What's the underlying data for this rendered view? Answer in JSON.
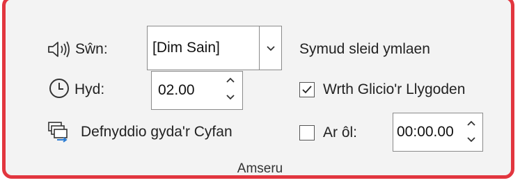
{
  "sound": {
    "label": "Sŵn:",
    "value": "[Dim Sain]"
  },
  "advance_label": "Symud sleid ymlaen",
  "duration": {
    "label": "Hyd:",
    "value": "02.00"
  },
  "on_mouse_click": {
    "label": "Wrth Glicio'r Llygoden",
    "checked": true
  },
  "apply_all": {
    "label": "Defnyddio gyda'r Cyfan"
  },
  "after": {
    "label": "Ar ôl:",
    "checked": false,
    "value": "00:00.00"
  },
  "group_label": "Amseru",
  "colors": {
    "highlight_border": "#e2363f",
    "panel_background": "#f3f3f3",
    "icon_accent": "#2b7cd3"
  }
}
